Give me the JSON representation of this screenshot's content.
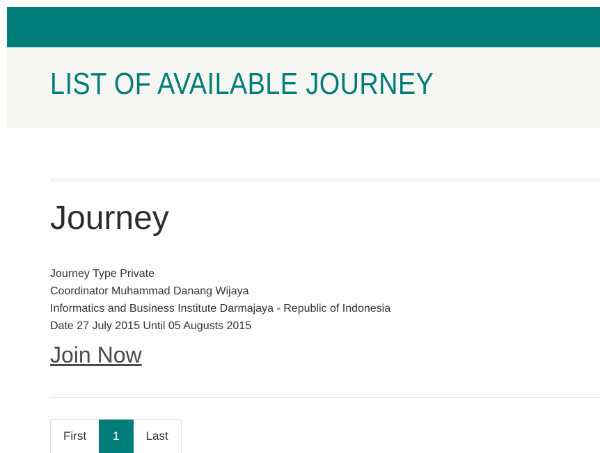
{
  "header": {
    "title": "LIST OF AVAILABLE JOURNEY"
  },
  "journey": {
    "heading": "Journey",
    "type_line": "Journey Type Private",
    "coordinator_line": "Coordinator Muhammad Danang Wijaya",
    "institution_line": "Informatics and Business Institute Darmajaya - Republic of Indonesia",
    "date_line": "Date 27 July 2015 Until 05 Augusts 2015",
    "join_label": "Join Now"
  },
  "pagination": {
    "first_label": "First",
    "current_page": "1",
    "last_label": "Last"
  },
  "colors": {
    "accent": "#007d78",
    "header_background": "#f6f6f3"
  }
}
